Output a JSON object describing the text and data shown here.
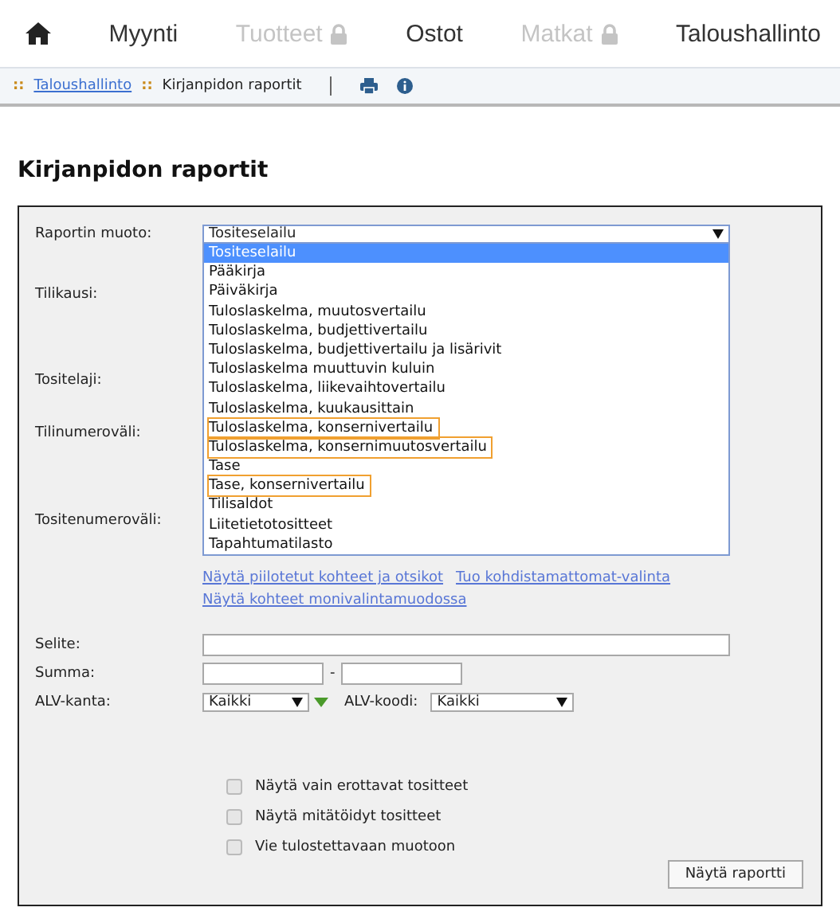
{
  "nav": {
    "items": [
      {
        "kind": "home"
      },
      {
        "kind": "link",
        "label": "Myynti",
        "disabled": false
      },
      {
        "kind": "link",
        "label": "Tuotteet",
        "disabled": true
      },
      {
        "kind": "link",
        "label": "Ostot",
        "disabled": false
      },
      {
        "kind": "link",
        "label": "Matkat",
        "disabled": true
      },
      {
        "kind": "link",
        "label": "Taloushallinto",
        "disabled": false
      }
    ]
  },
  "breadcrumb": {
    "separator": "::",
    "items": [
      {
        "label": "Taloushallinto",
        "link": true
      },
      {
        "label": "Kirjanpidon raportit",
        "link": false
      }
    ]
  },
  "page_title": "Kirjanpidon raportit",
  "form": {
    "report_type": {
      "label": "Raportin muoto:",
      "value": "Tositeselailu",
      "options": [
        {
          "label": "Tositeselailu",
          "selected": true,
          "highlighted": false
        },
        {
          "label": "Pääkirja",
          "selected": false,
          "highlighted": false
        },
        {
          "label": "Päiväkirja",
          "selected": false,
          "highlighted": false
        },
        {
          "label": "Tuloslaskelma, muutosvertailu",
          "selected": false,
          "highlighted": false
        },
        {
          "label": "Tuloslaskelma, budjettivertailu",
          "selected": false,
          "highlighted": false
        },
        {
          "label": "Tuloslaskelma, budjettivertailu ja lisärivit",
          "selected": false,
          "highlighted": false
        },
        {
          "label": "Tuloslaskelma muuttuvin kuluin",
          "selected": false,
          "highlighted": false
        },
        {
          "label": "Tuloslaskelma, liikevaihtovertailu",
          "selected": false,
          "highlighted": false
        },
        {
          "label": "Tuloslaskelma, kuukausittain",
          "selected": false,
          "highlighted": false
        },
        {
          "label": "Tuloslaskelma, konsernivertailu",
          "selected": false,
          "highlighted": true
        },
        {
          "label": "Tuloslaskelma, konsernimuutosvertailu",
          "selected": false,
          "highlighted": true
        },
        {
          "label": "Tase",
          "selected": false,
          "highlighted": false
        },
        {
          "label": "Tase, konsernivertailu",
          "selected": false,
          "highlighted": true
        },
        {
          "label": "Tilisaldot",
          "selected": false,
          "highlighted": false
        },
        {
          "label": "Liitetietotositteet",
          "selected": false,
          "highlighted": false
        },
        {
          "label": "Tapahtumatilasto",
          "selected": false,
          "highlighted": false
        }
      ]
    },
    "hidden_labels": [
      "Tilikausi:",
      "Tositelaji:",
      "Tilinumeroväli:",
      "Tositenumeroväli:"
    ],
    "links_row": [
      "Näytä piilotetut kohteet ja otsikot",
      "Tuo kohdistamattomat-valinta"
    ],
    "multiselect_link": "Näytä kohteet monivalintamuodossa",
    "selite": {
      "label": "Selite:"
    },
    "summa": {
      "label": "Summa:",
      "separator": "-"
    },
    "alv_kanta": {
      "label": "ALV-kanta:",
      "value": "Kaikki"
    },
    "alv_koodi": {
      "label": "ALV-koodi:",
      "value": "Kaikki"
    },
    "checkboxes": [
      {
        "label": "Näytä vain erottavat tositteet",
        "checked": false
      },
      {
        "label": "Näytä mitätöidyt tositteet",
        "checked": false
      },
      {
        "label": "Vie tulostettavaan muotoon",
        "checked": false
      }
    ],
    "submit": "Näytä raportti"
  }
}
